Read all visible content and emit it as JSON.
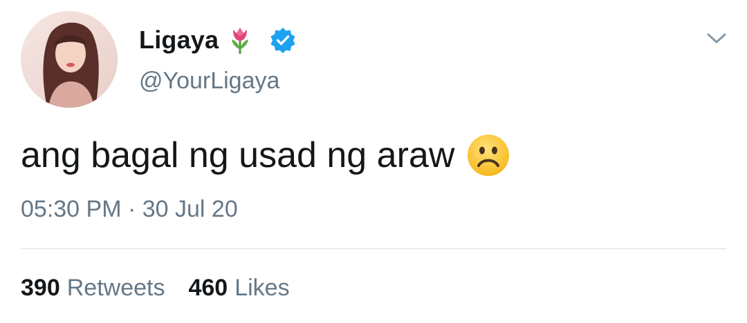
{
  "tweet": {
    "author": {
      "display_name": "Ligaya",
      "handle": "@YourLigaya",
      "name_emoji_icon": "tulip-icon",
      "verified_icon": "verified-badge-icon"
    },
    "text": "ang bagal ng usad ng araw",
    "text_emoji_icon": "frowning-face-icon",
    "timestamp": "05:30 PM · 30 Jul 20",
    "stats": {
      "retweets_count": "390",
      "retweets_label": "Retweets",
      "likes_count": "460",
      "likes_label": "Likes"
    },
    "menu_icon": "chevron-down-icon"
  },
  "colors": {
    "text_primary": "#14171a",
    "text_secondary": "#657786",
    "verified_blue": "#1da1f2",
    "divider": "#d8dde2"
  }
}
